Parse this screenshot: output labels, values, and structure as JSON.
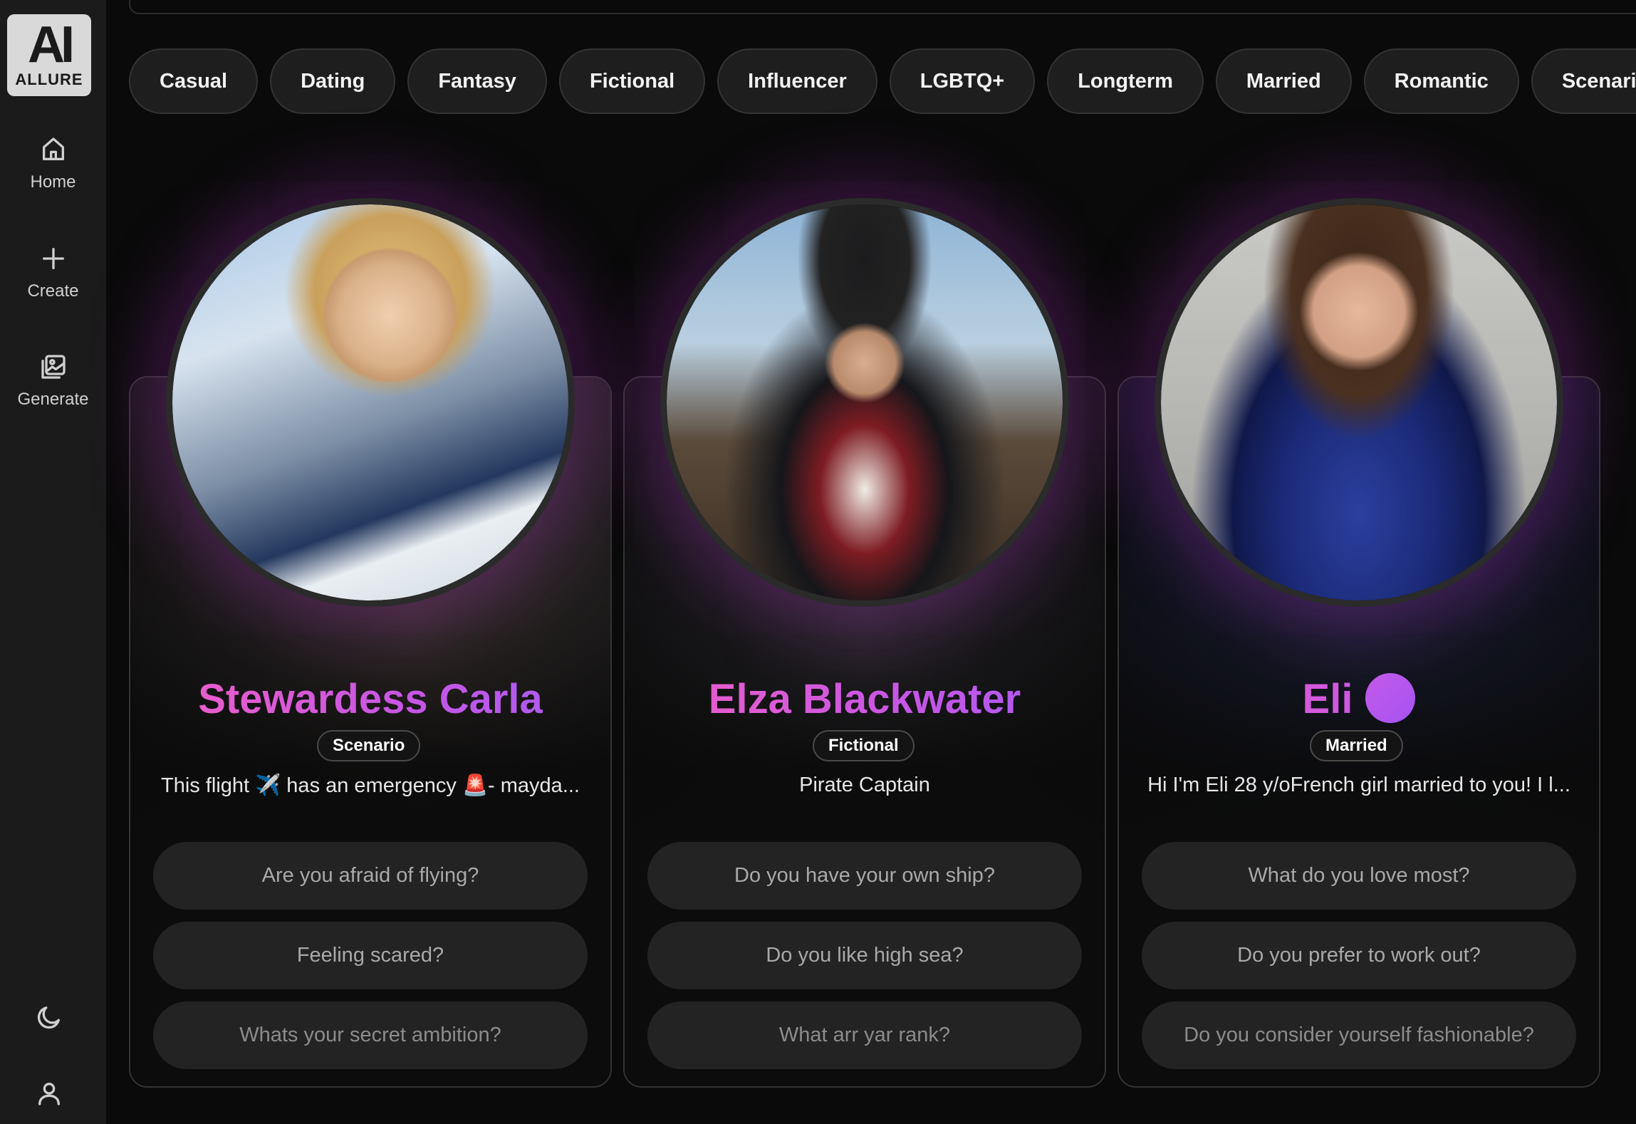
{
  "app": {
    "logo_mark": "AI",
    "logo_word": "ALLURE"
  },
  "sidebar": {
    "items": [
      {
        "label": "Home",
        "icon": "home-icon"
      },
      {
        "label": "Create",
        "icon": "plus-icon"
      },
      {
        "label": "Generate",
        "icon": "image-gallery-icon"
      }
    ],
    "bottom_icons": [
      "moon-icon",
      "user-icon"
    ]
  },
  "categories": [
    "Casual",
    "Dating",
    "Fantasy",
    "Fictional",
    "Influencer",
    "LGBTQ+",
    "Longterm",
    "Married",
    "Romantic",
    "Scenario"
  ],
  "characters": [
    {
      "name": "Stewardess Carla",
      "tag": "Scenario",
      "description": "This flight ✈️ has an emergency 🚨- mayda...",
      "questions": [
        "Are you afraid of flying?",
        "Feeling scared?",
        "Whats your secret ambition?"
      ]
    },
    {
      "name": "Elza Blackwater",
      "tag": "Fictional",
      "description": "Pirate Captain",
      "questions": [
        "Do you have your own ship?",
        "Do you like high sea?",
        "What arr yar rank?"
      ]
    },
    {
      "name": "Eli",
      "tag": "Married",
      "description": "Hi I'm Eli 28 y/oFrench girl married to you! I l...",
      "questions": [
        "What do you love most?",
        "Do you prefer to work out?",
        "Do you consider yourself fashionable?"
      ]
    }
  ],
  "colors": {
    "background": "#0a0a0a",
    "sidebar": "#1b1b1b",
    "name_gradient_start": "#f15fc4",
    "name_gradient_end": "#a45cf0",
    "glow": "#9628aa"
  }
}
